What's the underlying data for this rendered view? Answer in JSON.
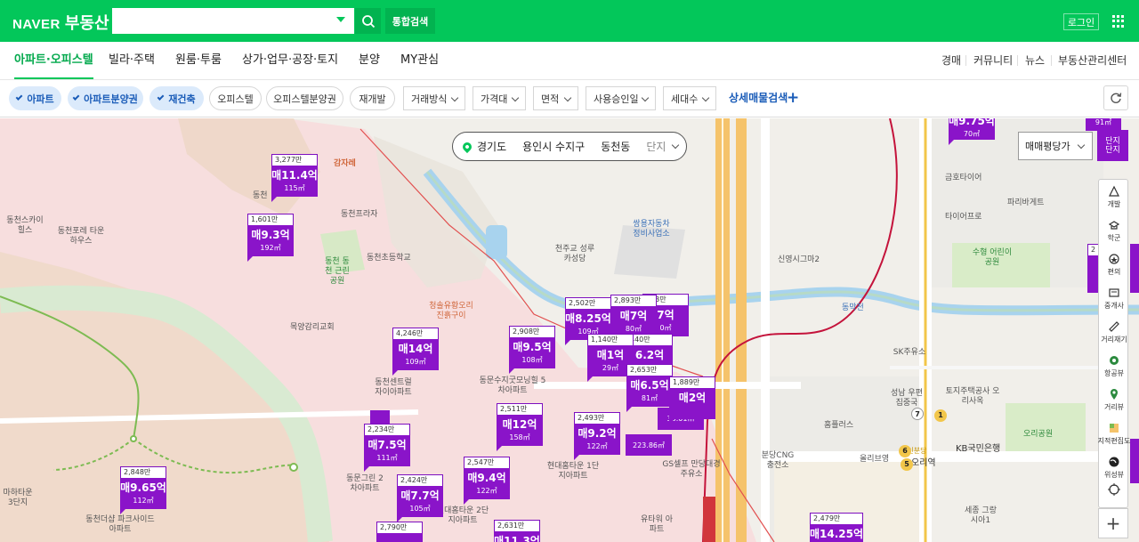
{
  "brand": {
    "naver": "NAVER",
    "service": "부동산"
  },
  "search": {
    "value": "",
    "placeholder": "",
    "total_label": "통합검색"
  },
  "header": {
    "login_label": "로그인"
  },
  "nav": {
    "tabs": [
      "아파트·오피스텔",
      "빌라·주택",
      "원룸·투룸",
      "상가·업무·공장·토지",
      "분양",
      "MY관심"
    ],
    "right": [
      "경매",
      "커뮤니티",
      "뉴스",
      "부동산관리센터"
    ]
  },
  "filters": {
    "chips_on": [
      "아파트",
      "아파트분양권",
      "재건축"
    ],
    "chips_off": [
      "오피스텔",
      "오피스텔분양권",
      "재개발"
    ],
    "dropdowns": [
      "거래방식",
      "가격대",
      "면적",
      "사용승인일",
      "세대수"
    ],
    "detail_label": "상세매물검색",
    "plus": "+"
  },
  "location": {
    "province": "경기도",
    "city": "용인시 수지구",
    "dong": "동천동",
    "scope": "단지"
  },
  "map_controls": {
    "price_per": "매매평당가",
    "complex_lines": [
      "단지",
      "단지"
    ],
    "tools": [
      "개발",
      "학군",
      "편의",
      "중개사",
      "거리재기",
      "항공뷰",
      "거리뷰",
      "지적편집도",
      "위성뷰",
      ""
    ],
    "zoom_plus": "+"
  },
  "colors": {
    "brand_green": "#03c75a",
    "marker_purple": "#8a14c9",
    "chip_blue": "#1a5cb8"
  },
  "places": [
    "감자레",
    "동천프라자",
    "동천스카이 힐스",
    "동천포레 타운하우스",
    "동천 동천 근린공원",
    "동천초등학교",
    "청솔유황오리 진흙구이",
    "목양감리교회",
    "동천센트럴 자이아파트",
    "동문수지굿모닝힐 5차아파트",
    "천주교 성루카성당",
    "쌍용자동차 정비사업소",
    "신영시그마2",
    "파리바게트",
    "금호타이어",
    "타이어프로",
    "수형 어린이공원",
    "SK주유소",
    "토지주택공사 오리사옥",
    "성남 우편집중국",
    "홈플러스",
    "올리브영",
    "분당CNG 충전소",
    "오리역",
    "KB국민은행",
    "오리공원",
    "세종 그랑시아1",
    "동천더샵 파크사이드아파트",
    "마하타운 3단지",
    "현대홈타운 1단지아파트",
    "현대홈타운 2단지아파트",
    "동문그린 2차아파트",
    "GS셀프 만당대경주유소",
    "유타워 아파트",
    "동막천",
    "수인분당",
    "동천"
  ],
  "listings": [
    {
      "price": "3,277만",
      "label": "매11.4억",
      "area": "115㎡"
    },
    {
      "price": "1,601만",
      "label": "매9.3억",
      "area": "192㎡"
    },
    {
      "price": "4,246만",
      "label": "매14억",
      "area": "109㎡"
    },
    {
      "price": "2,908만",
      "label": "매9.5억",
      "area": "108㎡"
    },
    {
      "price": "2,502만",
      "label": "매8.25억",
      "area": "109㎡"
    },
    {
      "price": "2,893만",
      "label": "매7억",
      "area": "80㎡"
    },
    {
      "price": "893만",
      "label": "7억",
      "area": "0㎡"
    },
    {
      "price": "1,140만",
      "label": "매1억",
      "area": "29㎡"
    },
    {
      "price": "440만",
      "label": "6.2억",
      "area": ""
    },
    {
      "price": "2,653만",
      "label": "매6.5억",
      "area": "81㎡"
    },
    {
      "price": "1,889만",
      "label": "매2억",
      "area": "30.01㎡"
    },
    {
      "price": "2,511만",
      "label": "매12억",
      "area": "158㎡"
    },
    {
      "price": "2,493만",
      "label": "매9.2억",
      "area": "122㎡"
    },
    {
      "price": "",
      "label": "",
      "area": "223.86㎡"
    },
    {
      "price": "2,234만",
      "label": "매7.5억",
      "area": "111㎡"
    },
    {
      "price": "2,848만",
      "label": "매9.65억",
      "area": "112㎡"
    },
    {
      "price": "2,424만",
      "label": "매7.7억",
      "area": "105㎡"
    },
    {
      "price": "2,547만",
      "label": "매9.4억",
      "area": "122㎡"
    },
    {
      "price": "2,790만",
      "label": "",
      "area": ""
    },
    {
      "price": "2,631만",
      "label": "매11.3억",
      "area": ""
    },
    {
      "price": "2,479만",
      "label": "매14.25억",
      "area": ""
    },
    {
      "price": "",
      "label": "매9.75억",
      "area": "70㎡"
    },
    {
      "price": "",
      "label": "",
      "area": "91㎡"
    },
    {
      "price": "2",
      "label": "",
      "area": ""
    }
  ],
  "station_badges": [
    "7",
    "1",
    "6",
    "5"
  ]
}
